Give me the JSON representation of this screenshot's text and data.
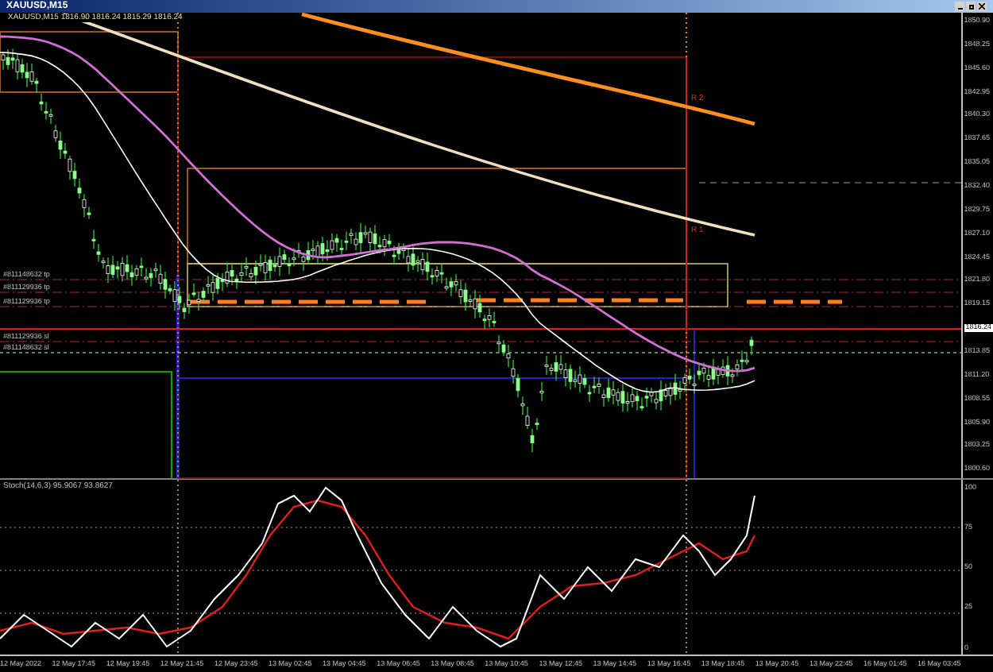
{
  "window": {
    "title": "XAUUSD,M15"
  },
  "chart": {
    "info_line": "XAUUSD,M15 1816.90 1816.24 1815.29 1816.24",
    "price_axis": [
      {
        "kind": "tick",
        "label": "1850.90"
      },
      {
        "kind": "tick",
        "label": "1848.25"
      },
      {
        "kind": "tick",
        "label": "1845.60"
      },
      {
        "kind": "tick",
        "label": "1842.95"
      },
      {
        "kind": "tick",
        "label": "1840.30"
      },
      {
        "kind": "tick",
        "label": "1837.65"
      },
      {
        "kind": "tick",
        "label": "1835.05"
      },
      {
        "kind": "tick",
        "label": "1832.40"
      },
      {
        "kind": "tick",
        "label": "1829.75"
      },
      {
        "kind": "tick",
        "label": "1827.10"
      },
      {
        "kind": "tick",
        "label": "1824.45"
      },
      {
        "kind": "tick",
        "label": "1821.80"
      },
      {
        "kind": "tick",
        "label": "1819.15"
      },
      {
        "kind": "current",
        "label": "1816.24"
      },
      {
        "kind": "tick",
        "label": "1813.85"
      },
      {
        "kind": "tick",
        "label": "1811.20"
      },
      {
        "kind": "tick",
        "label": "1808.55"
      },
      {
        "kind": "tick",
        "label": "1805.90"
      },
      {
        "kind": "tick",
        "label": "1803.25"
      },
      {
        "kind": "tick",
        "label": "1800.60"
      }
    ],
    "order_labels": [
      "#811148632 tp",
      "#811129936 tp",
      "#811129936 tp",
      "#811129936 sl",
      "#811148632 sl"
    ],
    "zone_labels": [
      "R 2",
      "R 1"
    ]
  },
  "oscillator": {
    "label": "Stoch(14,6,3) 95.9067 93.8627",
    "scale_labels": [
      "100",
      "75",
      "50",
      "25",
      "0"
    ]
  },
  "time_labels": [
    "12 May 2022",
    "12 May 17:45",
    "12 May 19:45",
    "12 May 21:45",
    "12 May 23:45",
    "13 May 02:45",
    "13 May 04:45",
    "13 May 06:45",
    "13 May 08:45",
    "13 May 10:45",
    "13 May 12:45",
    "13 May 14:45",
    "13 May 16:45",
    "13 May 18:45",
    "13 May 20:45",
    "13 May 22:45",
    "16 May 01:45",
    "16 May 03:45"
  ]
}
